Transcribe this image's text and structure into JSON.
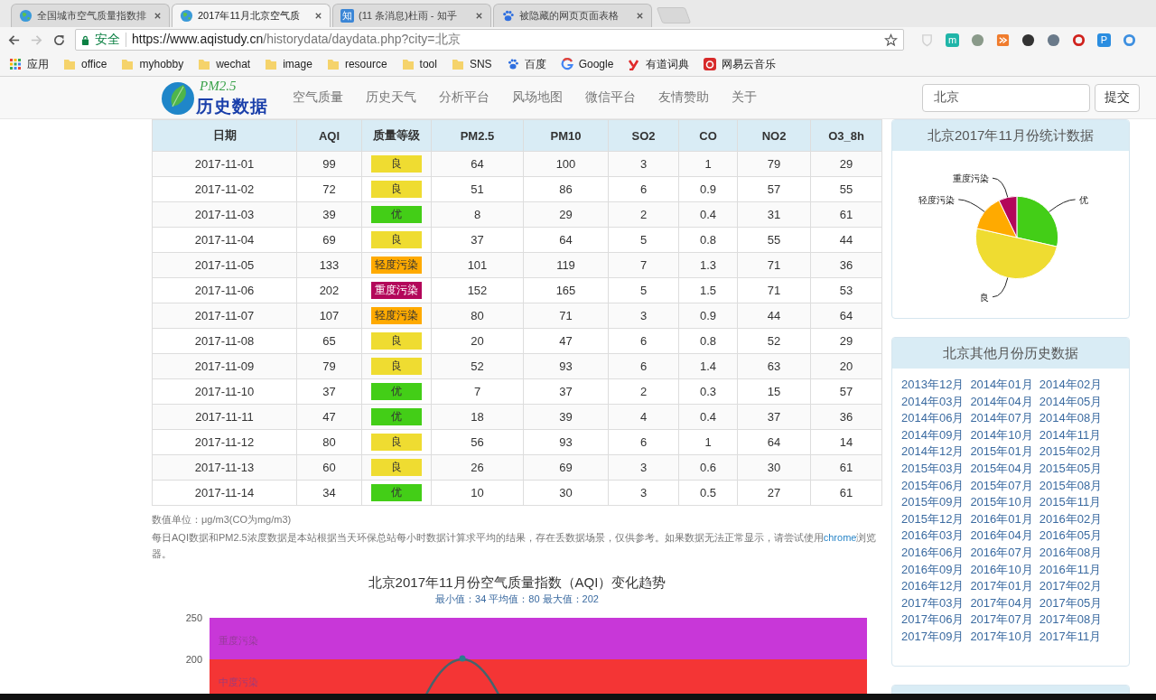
{
  "browser": {
    "tabs": [
      {
        "title": "全国城市空气质量指数排",
        "kind": "globe",
        "selected": false
      },
      {
        "title": "2017年11月北京空气质",
        "kind": "globe",
        "selected": true
      },
      {
        "title": "(11 条消息)杜雨 - 知乎",
        "kind": "badge",
        "icon_text": "知",
        "selected": false
      },
      {
        "title": "被隐藏的网页页面表格",
        "kind": "paw",
        "selected": false
      }
    ],
    "security": "安全",
    "url_host": "https://www.aqistudy.cn",
    "url_path": "/historydata/daydata.php?city=北京",
    "extensions": [
      {
        "kind": "shield",
        "color": "#d0d0d0"
      },
      {
        "kind": "letter",
        "label": "m",
        "color": "#1fb5a8"
      },
      {
        "kind": "dot",
        "color": "#8a9a8a"
      },
      {
        "kind": "tile",
        "color": "#f07c2d"
      },
      {
        "kind": "dot",
        "color": "#333333"
      },
      {
        "kind": "dot",
        "color": "#6a7a8a"
      },
      {
        "kind": "ring",
        "color": "#d0211c"
      },
      {
        "kind": "letter",
        "label": "P",
        "color": "#2a8de0"
      },
      {
        "kind": "ring",
        "color": "#3d8fe0"
      }
    ],
    "bookmarks": [
      {
        "label": "应用",
        "kind": "apps"
      },
      {
        "label": "office",
        "kind": "folder"
      },
      {
        "label": "myhobby",
        "kind": "folder"
      },
      {
        "label": "wechat",
        "kind": "folder"
      },
      {
        "label": "image",
        "kind": "folder"
      },
      {
        "label": "resource",
        "kind": "folder"
      },
      {
        "label": "tool",
        "kind": "folder"
      },
      {
        "label": "SNS",
        "kind": "folder"
      },
      {
        "label": "百度",
        "kind": "paw"
      },
      {
        "label": "Google",
        "kind": "google"
      },
      {
        "label": "有道词典",
        "kind": "youdao"
      },
      {
        "label": "网易云音乐",
        "kind": "netease"
      }
    ]
  },
  "site": {
    "logo": {
      "tag": "PM2.5",
      "name": "历史数据"
    },
    "nav": [
      "空气质量",
      "历史天气",
      "分析平台",
      "风场地图",
      "微信平台",
      "友情赞助",
      "关于"
    ],
    "search": {
      "value": "北京"
    },
    "submit": "提交"
  },
  "table": {
    "columns": [
      "日期",
      "AQI",
      "质量等级",
      "PM2.5",
      "PM10",
      "SO2",
      "CO",
      "NO2",
      "O3_8h"
    ],
    "rows": [
      {
        "date": "2017-11-01",
        "aqi": "99",
        "grade": {
          "label": "良",
          "kind": "good"
        },
        "values": [
          "64",
          "100",
          "3",
          "1",
          "79",
          "29"
        ]
      },
      {
        "date": "2017-11-02",
        "aqi": "72",
        "grade": {
          "label": "良",
          "kind": "good"
        },
        "values": [
          "51",
          "86",
          "6",
          "0.9",
          "57",
          "55"
        ]
      },
      {
        "date": "2017-11-03",
        "aqi": "39",
        "grade": {
          "label": "优",
          "kind": "excellent"
        },
        "values": [
          "8",
          "29",
          "2",
          "0.4",
          "31",
          "61"
        ]
      },
      {
        "date": "2017-11-04",
        "aqi": "69",
        "grade": {
          "label": "良",
          "kind": "good"
        },
        "values": [
          "37",
          "64",
          "5",
          "0.8",
          "55",
          "44"
        ]
      },
      {
        "date": "2017-11-05",
        "aqi": "133",
        "grade": {
          "label": "轻度污染",
          "kind": "light"
        },
        "values": [
          "101",
          "119",
          "7",
          "1.3",
          "71",
          "36"
        ]
      },
      {
        "date": "2017-11-06",
        "aqi": "202",
        "grade": {
          "label": "重度污染",
          "kind": "heavy"
        },
        "values": [
          "152",
          "165",
          "5",
          "1.5",
          "71",
          "53"
        ]
      },
      {
        "date": "2017-11-07",
        "aqi": "107",
        "grade": {
          "label": "轻度污染",
          "kind": "light"
        },
        "values": [
          "80",
          "71",
          "3",
          "0.9",
          "44",
          "64"
        ]
      },
      {
        "date": "2017-11-08",
        "aqi": "65",
        "grade": {
          "label": "良",
          "kind": "good"
        },
        "values": [
          "20",
          "47",
          "6",
          "0.8",
          "52",
          "29"
        ]
      },
      {
        "date": "2017-11-09",
        "aqi": "79",
        "grade": {
          "label": "良",
          "kind": "good"
        },
        "values": [
          "52",
          "93",
          "6",
          "1.4",
          "63",
          "20"
        ]
      },
      {
        "date": "2017-11-10",
        "aqi": "37",
        "grade": {
          "label": "优",
          "kind": "excellent"
        },
        "values": [
          "7",
          "37",
          "2",
          "0.3",
          "15",
          "57"
        ]
      },
      {
        "date": "2017-11-11",
        "aqi": "47",
        "grade": {
          "label": "优",
          "kind": "excellent"
        },
        "values": [
          "18",
          "39",
          "4",
          "0.4",
          "37",
          "36"
        ]
      },
      {
        "date": "2017-11-12",
        "aqi": "80",
        "grade": {
          "label": "良",
          "kind": "good"
        },
        "values": [
          "56",
          "93",
          "6",
          "1",
          "64",
          "14"
        ]
      },
      {
        "date": "2017-11-13",
        "aqi": "60",
        "grade": {
          "label": "良",
          "kind": "good"
        },
        "values": [
          "26",
          "69",
          "3",
          "0.6",
          "30",
          "61"
        ]
      },
      {
        "date": "2017-11-14",
        "aqi": "34",
        "grade": {
          "label": "优",
          "kind": "excellent"
        },
        "values": [
          "10",
          "30",
          "3",
          "0.5",
          "27",
          "61"
        ]
      }
    ]
  },
  "notes": {
    "unit": "数值单位：μg/m3(CO为mg/m3)",
    "text_before": "每日AQI数据和PM2.5浓度数据是本站根据当天环保总站每小时数据计算求平均的结果，存在丢数据场景，仅供参考。如果数据无法正常显示，请尝试使用",
    "link": "chrome",
    "text_after": "浏览器。"
  },
  "trend": {
    "title": "北京2017年11月份空气质量指数（AQI）变化趋势",
    "subtitle": "最小值：34 平均值：80 最大值：202",
    "y_ticks": [
      "250",
      "200"
    ],
    "bands": [
      "重度污染",
      "中度污染"
    ]
  },
  "stats": {
    "title": "北京2017年11月份统计数据",
    "slices": [
      {
        "label": "优",
        "kind": "excellent"
      },
      {
        "label": "良",
        "kind": "good"
      },
      {
        "label": "轻度污染",
        "kind": "light"
      },
      {
        "label": "重度污染",
        "kind": "heavy"
      }
    ]
  },
  "history": {
    "title": "北京其他月份历史数据",
    "months": [
      "2013年12月",
      "2014年01月",
      "2014年02月",
      "2014年03月",
      "2014年04月",
      "2014年05月",
      "2014年06月",
      "2014年07月",
      "2014年08月",
      "2014年09月",
      "2014年10月",
      "2014年11月",
      "2014年12月",
      "2015年01月",
      "2015年02月",
      "2015年03月",
      "2015年04月",
      "2015年05月",
      "2015年06月",
      "2015年07月",
      "2015年08月",
      "2015年09月",
      "2015年10月",
      "2015年11月",
      "2015年12月",
      "2016年01月",
      "2016年02月",
      "2016年03月",
      "2016年04月",
      "2016年05月",
      "2016年06月",
      "2016年07月",
      "2016年08月",
      "2016年09月",
      "2016年10月",
      "2016年11月",
      "2016年12月",
      "2017年01月",
      "2017年02月",
      "2017年03月",
      "2017年04月",
      "2017年05月",
      "2017年06月",
      "2017年07月",
      "2017年08月",
      "2017年09月",
      "2017年10月",
      "2017年11月"
    ]
  }
}
